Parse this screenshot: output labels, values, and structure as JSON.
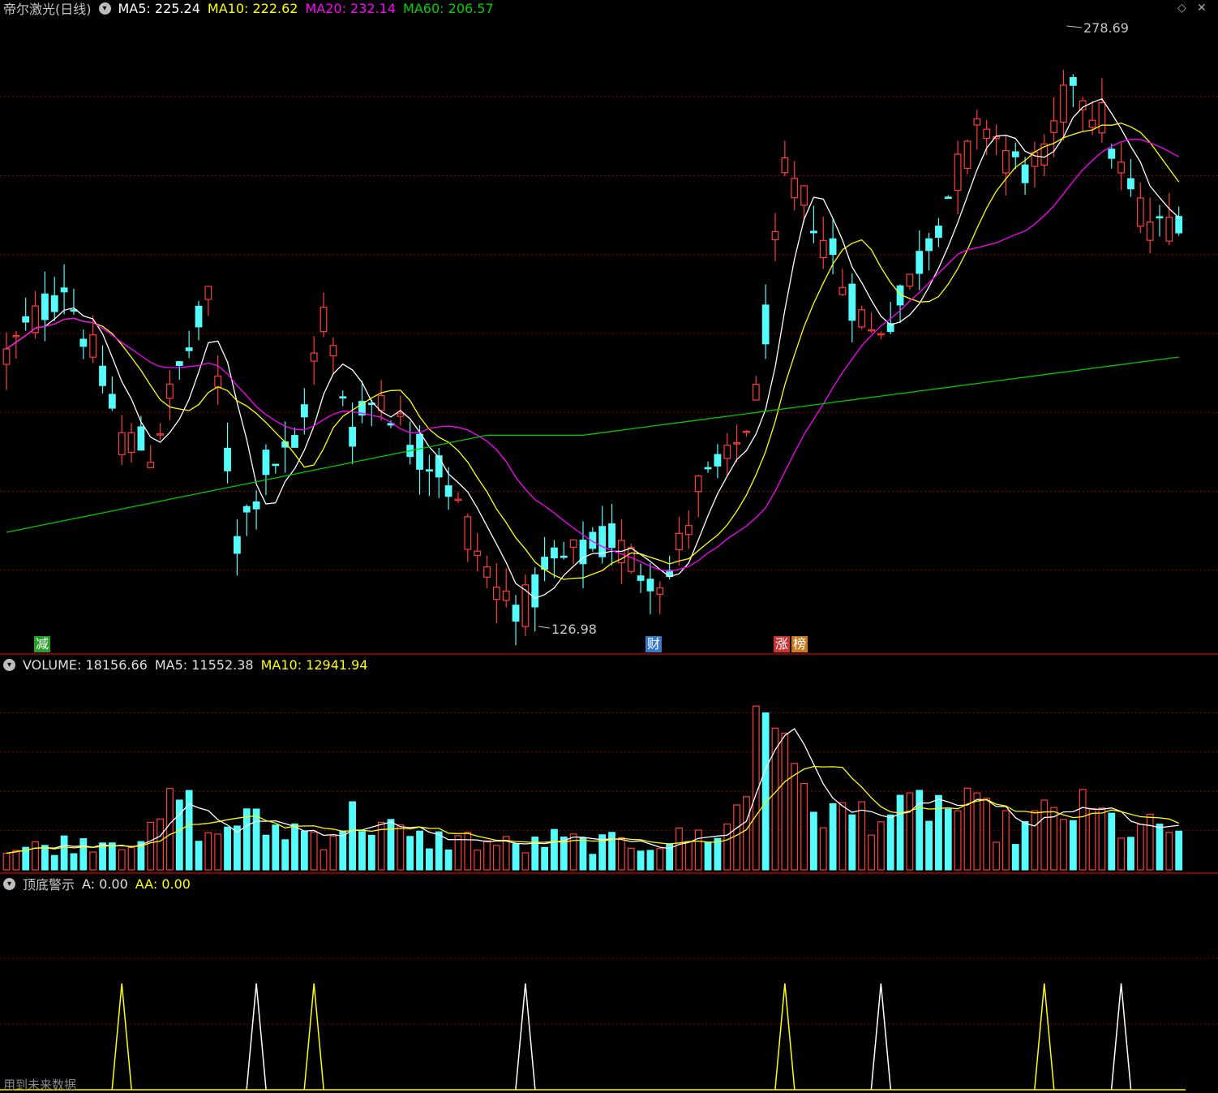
{
  "title": "帝尔激光(日线)",
  "price_panel": {
    "ma5_label": "MA5: 225.24",
    "ma10_label": "MA10: 222.62",
    "ma20_label": "MA20: 232.14",
    "ma60_label": "MA60: 206.57",
    "high_label": "278.69",
    "low_label": "126.98"
  },
  "volume_panel": {
    "volume_label": "VOLUME: 18156.66",
    "ma5_label": "MA5: 11552.38",
    "ma10_label": "MA10: 12941.94"
  },
  "indicator_panel": {
    "name": "顶底警示",
    "a_label": "A: 0.00",
    "aa_label": "AA: 0.00",
    "footer_note": "用到未来数据"
  },
  "badges": [
    {
      "text": "减",
      "color": "#2a9d2a"
    },
    {
      "text": "财",
      "color": "#3a78c8"
    },
    {
      "text": "涨",
      "color": "#c83232"
    },
    {
      "text": "榜",
      "color": "#c87a1e"
    }
  ],
  "window_controls": {
    "diamond": "◇",
    "close": "✕"
  },
  "colors": {
    "up": "#ff3c3c",
    "down": "#54fcfc",
    "ma5": "#ffffff",
    "ma10": "#ffff00",
    "ma20": "#ff00ff",
    "ma60": "#00c800",
    "grid": "#8b0000",
    "separator": "#b40000"
  },
  "chart_data": {
    "type": "candlestick",
    "price_range": [
      126.98,
      278.69
    ],
    "ma60_range": [
      150,
      198
    ],
    "price_path": [
      [
        0,
        198
      ],
      [
        6,
        218
      ],
      [
        9,
        198
      ],
      [
        12,
        176
      ],
      [
        15,
        172
      ],
      [
        18,
        194
      ],
      [
        21,
        212
      ],
      [
        24,
        148
      ],
      [
        27,
        168
      ],
      [
        30,
        172
      ],
      [
        33,
        209
      ],
      [
        36,
        178
      ],
      [
        39,
        189
      ],
      [
        42,
        174
      ],
      [
        45,
        168
      ],
      [
        48,
        151
      ],
      [
        51,
        134
      ],
      [
        54,
        130
      ],
      [
        57,
        141
      ],
      [
        60,
        144
      ],
      [
        63,
        148
      ],
      [
        66,
        140
      ],
      [
        69,
        138
      ],
      [
        72,
        162
      ],
      [
        75,
        168
      ],
      [
        78,
        186
      ],
      [
        81,
        246
      ],
      [
        84,
        236
      ],
      [
        87,
        218
      ],
      [
        90,
        204
      ],
      [
        93,
        212
      ],
      [
        96,
        230
      ],
      [
        99,
        248
      ],
      [
        102,
        262
      ],
      [
        105,
        249
      ],
      [
        108,
        250
      ],
      [
        111,
        274
      ],
      [
        114,
        262
      ],
      [
        117,
        241
      ],
      [
        120,
        232
      ],
      [
        123,
        240
      ]
    ],
    "volume_path": [
      [
        0,
        5
      ],
      [
        9,
        8
      ],
      [
        15,
        9
      ],
      [
        18,
        20
      ],
      [
        21,
        8
      ],
      [
        24,
        14
      ],
      [
        27,
        11
      ],
      [
        30,
        11
      ],
      [
        33,
        9
      ],
      [
        36,
        14
      ],
      [
        39,
        12
      ],
      [
        42,
        8
      ],
      [
        45,
        8
      ],
      [
        48,
        8
      ],
      [
        51,
        7
      ],
      [
        54,
        6
      ],
      [
        57,
        8
      ],
      [
        60,
        7
      ],
      [
        63,
        7
      ],
      [
        66,
        7
      ],
      [
        69,
        8
      ],
      [
        72,
        9
      ],
      [
        75,
        11
      ],
      [
        78,
        26
      ],
      [
        81,
        22
      ],
      [
        84,
        18
      ],
      [
        87,
        14
      ],
      [
        90,
        16
      ],
      [
        93,
        14
      ],
      [
        96,
        18
      ],
      [
        99,
        16
      ],
      [
        102,
        14
      ],
      [
        105,
        10
      ],
      [
        108,
        14
      ],
      [
        111,
        16
      ],
      [
        114,
        14
      ],
      [
        117,
        10
      ],
      [
        120,
        11
      ],
      [
        123,
        11
      ]
    ],
    "volume_range": [
      0,
      55
    ],
    "indicator_peaks": [
      {
        "bar": 12,
        "series": "AA"
      },
      {
        "bar": 26,
        "series": "A"
      },
      {
        "bar": 32,
        "series": "AA"
      },
      {
        "bar": 54,
        "series": "A"
      },
      {
        "bar": 81,
        "series": "AA"
      },
      {
        "bar": 91,
        "series": "A"
      },
      {
        "bar": 108,
        "series": "AA"
      },
      {
        "bar": 116,
        "series": "A"
      }
    ],
    "bars": 123
  }
}
